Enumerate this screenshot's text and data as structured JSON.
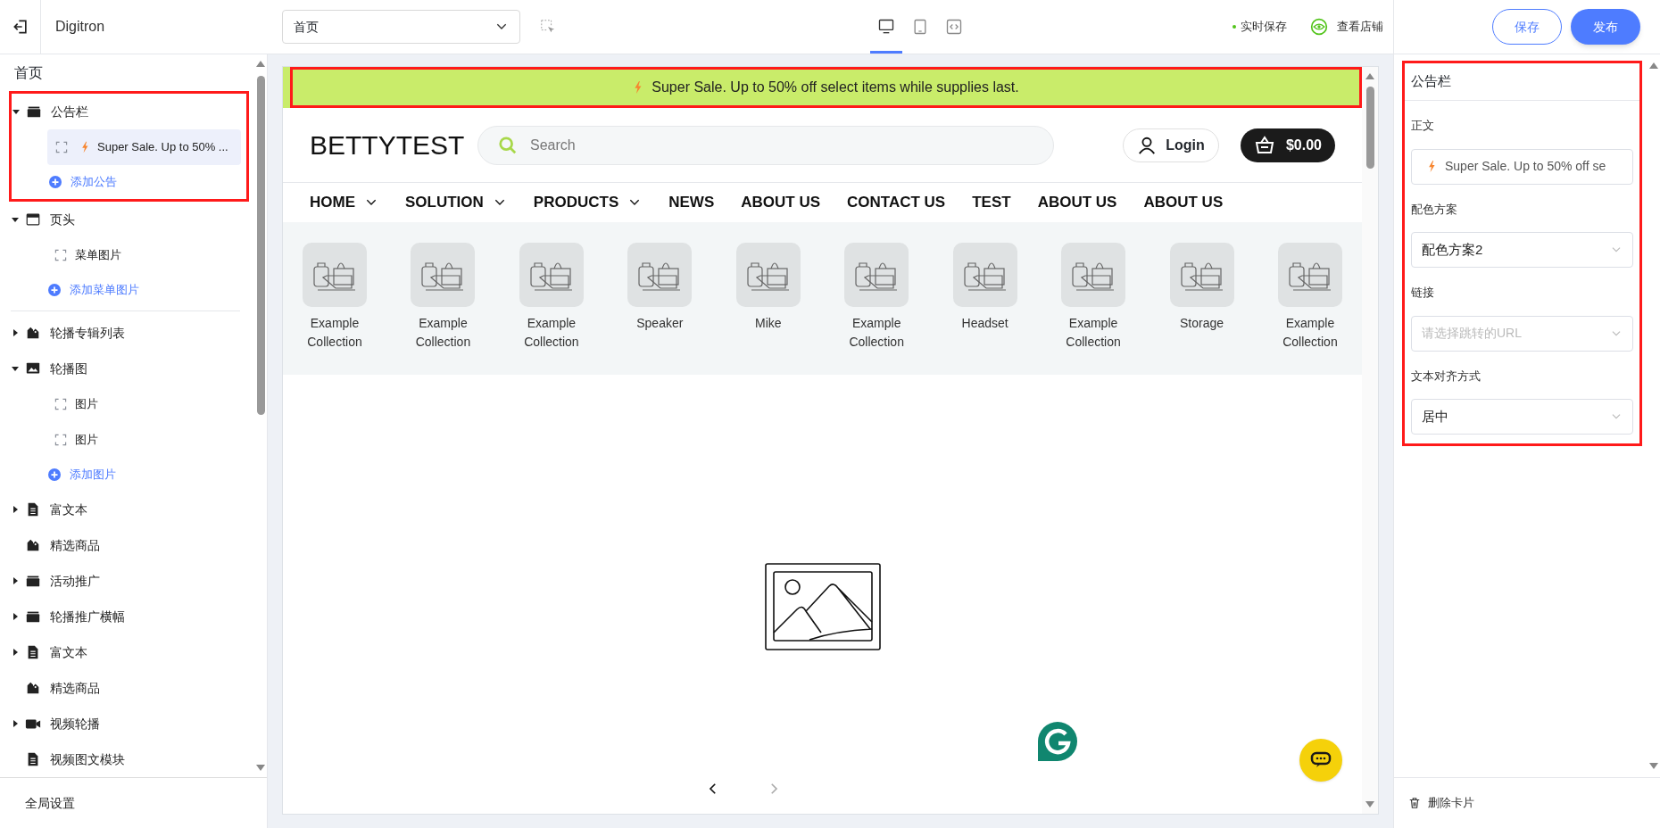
{
  "topbar": {
    "brand": "Digitron",
    "page_select": {
      "value": "首页"
    },
    "devices": [
      {
        "kind": "desktop",
        "selected": true
      },
      {
        "kind": "tablet",
        "selected": false
      },
      {
        "kind": "code",
        "selected": false
      }
    ],
    "autosave": "实时保存",
    "view_store": "查看店铺",
    "save": "保存",
    "publish": "发布"
  },
  "outline": {
    "title": "首页",
    "sections": [
      {
        "kind": "announcement",
        "label": "公告栏",
        "expanded": true,
        "highlighted": true,
        "children": [
          {
            "label": "Super Sale. Up to 50% ...",
            "selected": true,
            "bolt": true
          }
        ],
        "add_label": "添加公告"
      },
      {
        "kind": "header",
        "label": "页头",
        "expanded": true,
        "divider_after": true,
        "children": [
          {
            "label": "菜单图片",
            "selected": false
          }
        ],
        "add_label": "添加菜单图片"
      },
      {
        "kind": "collection-list",
        "label": "轮播专辑列表",
        "expanded": false
      },
      {
        "kind": "slideshow",
        "label": "轮播图",
        "expanded": true,
        "children": [
          {
            "label": "图片",
            "selected": false
          },
          {
            "label": "图片",
            "selected": false
          }
        ],
        "add_label": "添加图片"
      },
      {
        "kind": "rich-text",
        "label": "富文本",
        "expanded": false
      },
      {
        "kind": "featured",
        "label": "精选商品"
      },
      {
        "kind": "promo",
        "label": "活动推广",
        "expanded": false
      },
      {
        "kind": "promo",
        "label": "轮播推广横幅",
        "expanded": false
      },
      {
        "kind": "rich-text",
        "label": "富文本",
        "expanded": false
      },
      {
        "kind": "featured",
        "label": "精选商品"
      },
      {
        "kind": "video",
        "label": "视频轮播",
        "expanded": false
      },
      {
        "kind": "rich-text",
        "label": "视频图文模块"
      }
    ],
    "footer": "全局设置"
  },
  "preview": {
    "announcement": {
      "text": "Super Sale. Up to 50% off select items while supplies last.",
      "highlighted": true
    },
    "logo": "BETTYTEST",
    "search": {
      "placeholder": "Search"
    },
    "login": "Login",
    "cart": "$0.00",
    "nav": [
      {
        "label": "HOME",
        "dropdown": true
      },
      {
        "label": "SOLUTION",
        "dropdown": true
      },
      {
        "label": "PRODUCTS",
        "dropdown": true
      },
      {
        "label": "NEWS",
        "dropdown": false
      },
      {
        "label": "ABOUT US",
        "dropdown": false
      },
      {
        "label": "CONTACT US",
        "dropdown": false
      },
      {
        "label": "TEST",
        "dropdown": false
      },
      {
        "label": "ABOUT US",
        "dropdown": false
      },
      {
        "label": "ABOUT US",
        "dropdown": false
      }
    ],
    "collections": [
      {
        "label": "Example Collection"
      },
      {
        "label": "Example Collection"
      },
      {
        "label": "Example Collection"
      },
      {
        "label": "Speaker"
      },
      {
        "label": "Mike"
      },
      {
        "label": "Example Collection"
      },
      {
        "label": "Headset"
      },
      {
        "label": "Example Collection"
      },
      {
        "label": "Storage"
      },
      {
        "label": "Example Collection"
      }
    ],
    "slider": {
      "prev_disabled": false,
      "next_disabled": true
    }
  },
  "settings": {
    "title": "公告栏",
    "highlighted": true,
    "fields": [
      {
        "kind": "text",
        "label": "正文",
        "value": "Super Sale. Up to 50% off se",
        "bolt": true
      },
      {
        "kind": "select",
        "label": "配色方案",
        "value": "配色方案2"
      },
      {
        "kind": "select",
        "label": "链接",
        "placeholder": "请选择跳转的URL"
      },
      {
        "kind": "select",
        "label": "文本对齐方式",
        "value": "居中"
      }
    ],
    "delete": "删除卡片"
  }
}
